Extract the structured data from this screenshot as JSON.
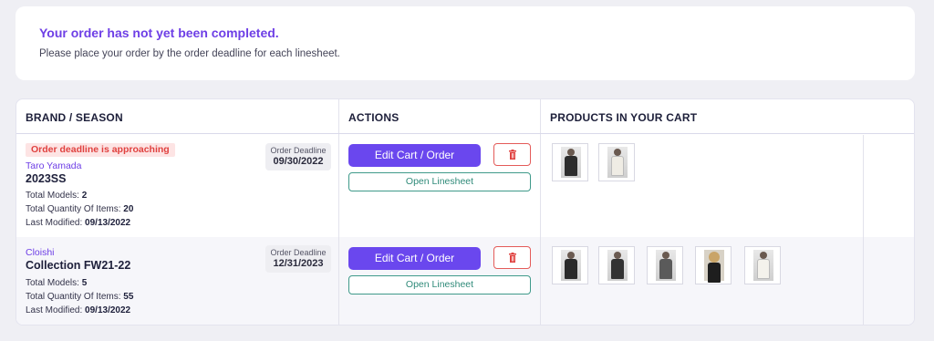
{
  "notice": {
    "title": "Your order has not yet been completed.",
    "text": "Please place your order by the order deadline for each linesheet."
  },
  "table": {
    "headers": {
      "brand": "BRAND / SEASON",
      "actions": "ACTIONS",
      "products": "PRODUCTS IN YOUR CART"
    },
    "rows": [
      {
        "warning": "Order deadline is approaching",
        "brand": "Taro Yamada",
        "season": "2023SS",
        "models_label": "Total Models:",
        "models": "2",
        "qty_label": "Total Quantity Of Items:",
        "qty": "20",
        "modified_label": "Last Modified:",
        "modified": "09/13/2022",
        "deadline_label": "Order Deadline",
        "deadline": "09/30/2022",
        "edit_label": "Edit Cart / Order",
        "open_label": "Open Linesheet",
        "products": [
          "black-top",
          "white-knit"
        ]
      },
      {
        "warning": "",
        "brand": "Cloishi",
        "season": "Collection FW21-22",
        "models_label": "Total Models:",
        "models": "5",
        "qty_label": "Total Quantity Of Items:",
        "qty": "55",
        "modified_label": "Last Modified:",
        "modified": "09/13/2022",
        "deadline_label": "Order Deadline",
        "deadline": "12/31/2023",
        "edit_label": "Edit Cart / Order",
        "open_label": "Open Linesheet",
        "products": [
          "black-vest",
          "black-dress",
          "grey-jacket",
          "portrait",
          "white-dress"
        ]
      }
    ]
  },
  "colors": {
    "accent": "#6a47ee",
    "warning": "#e0413f",
    "teal": "#2f8a79"
  },
  "icons": {
    "delete": "trash-icon"
  }
}
